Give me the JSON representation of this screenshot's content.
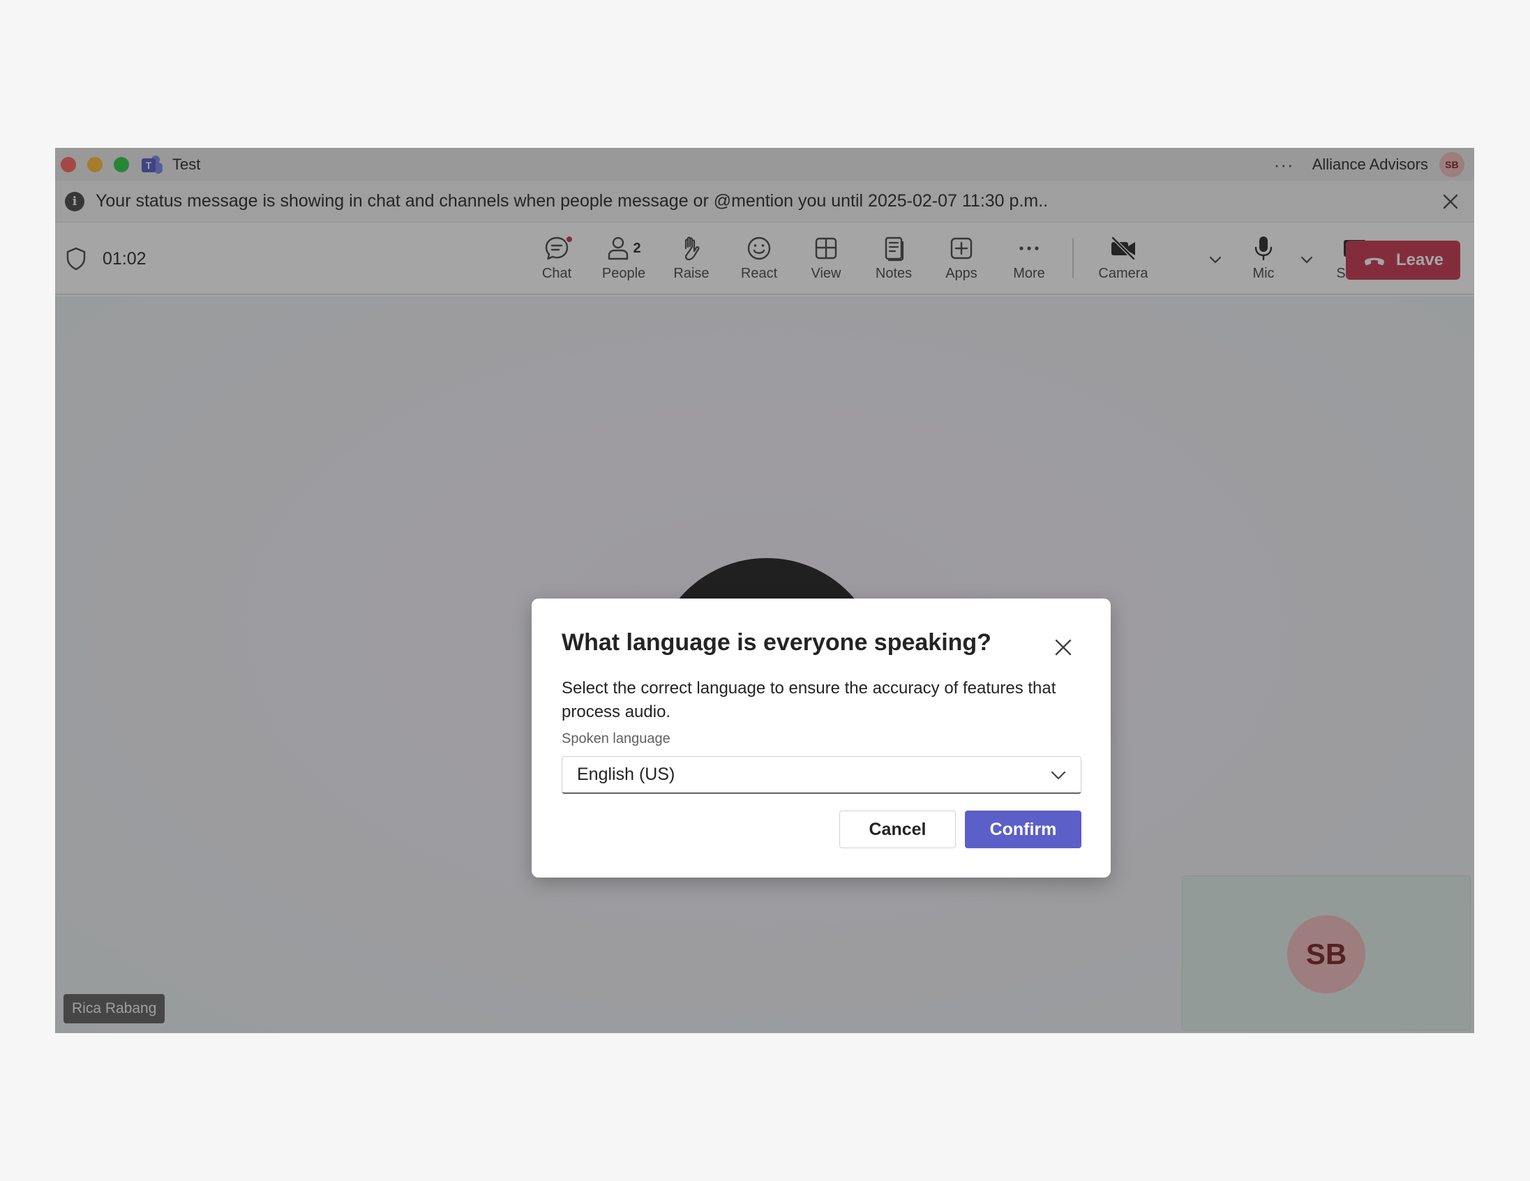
{
  "window": {
    "title": "Test",
    "org_name": "Alliance Advisors",
    "user_initials": "SB"
  },
  "banner": {
    "message": "Your status message is showing in chat and channels when people message or @mention you until 2025-02-07 11:30 p.m.."
  },
  "meeting": {
    "timer": "01:02",
    "participant_name": "Rica Rabang",
    "self_initials": "SB"
  },
  "toolbar": {
    "chat": "Chat",
    "people": "People",
    "people_count": "2",
    "raise": "Raise",
    "react": "React",
    "view": "View",
    "notes": "Notes",
    "apps": "Apps",
    "more": "More",
    "camera": "Camera",
    "mic": "Mic",
    "share": "Share",
    "leave": "Leave"
  },
  "dialog": {
    "title": "What language is everyone speaking?",
    "description": "Select the correct language to ensure the accuracy of features that process audio.",
    "field_label": "Spoken language",
    "selected_language": "English (US)",
    "cancel": "Cancel",
    "confirm": "Confirm"
  },
  "colors": {
    "accent": "#5b5fc7",
    "leave": "#c4314b",
    "avatar_bg": "#f1bbbc",
    "avatar_text": "#751d1f"
  }
}
